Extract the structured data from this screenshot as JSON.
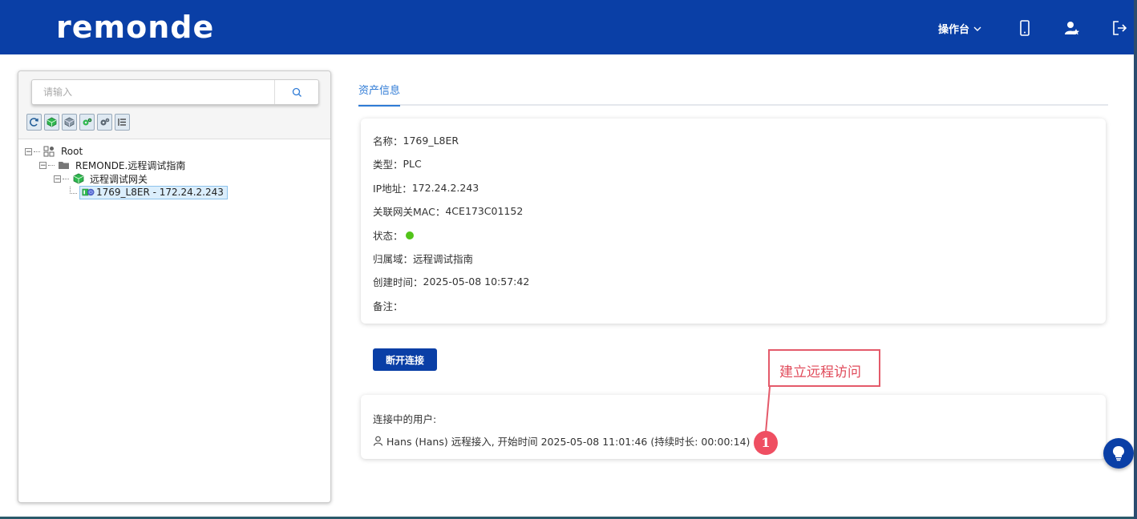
{
  "header": {
    "logo_text": "remonde",
    "console_label": "操作台",
    "icons": [
      "mobile-icon",
      "user-star-icon",
      "logout-icon"
    ],
    "brand_color": "#0a3fa6"
  },
  "left": {
    "search_placeholder": "请输入",
    "toolbar_icons": [
      "refresh-icon",
      "green-cube-icon",
      "gray-cube-icon",
      "gear-green-icon",
      "gear-gray-icon",
      "list-icon"
    ],
    "tree": {
      "root_label": "Root",
      "domain_label": "REMONDE.远程调试指南",
      "gateway_label": "远程调试网关",
      "device_label": "1769_L8ER - 172.24.2.243"
    }
  },
  "tabs": {
    "asset_info": "资产信息"
  },
  "asset": {
    "name_label": "名称：",
    "name_value": "1769_L8ER",
    "type_label": "类型：",
    "type_value": "PLC",
    "ip_label": "IP地址：",
    "ip_value": "172.24.2.243",
    "mac_label": "关联网关MAC：",
    "mac_value": "4CE173C01152",
    "status_label": "状态：",
    "status_color": "#52c41a",
    "domain_label": "归属域：",
    "domain_value": "远程调试指南",
    "created_label": "创建时间：",
    "created_value": "2025-05-08 10:57:42",
    "note_label": "备注："
  },
  "actions": {
    "disconnect_label": "断开连接"
  },
  "users": {
    "title": "连接中的用户:",
    "line": "Hans (Hans) 远程接入, 开始时间 2025-05-08 11:01:46 (持续时长: 00:00:14)"
  },
  "annotation": {
    "callout_text": "建立远程访问",
    "badge_number": "1",
    "accent_color": "#e45a6a"
  }
}
